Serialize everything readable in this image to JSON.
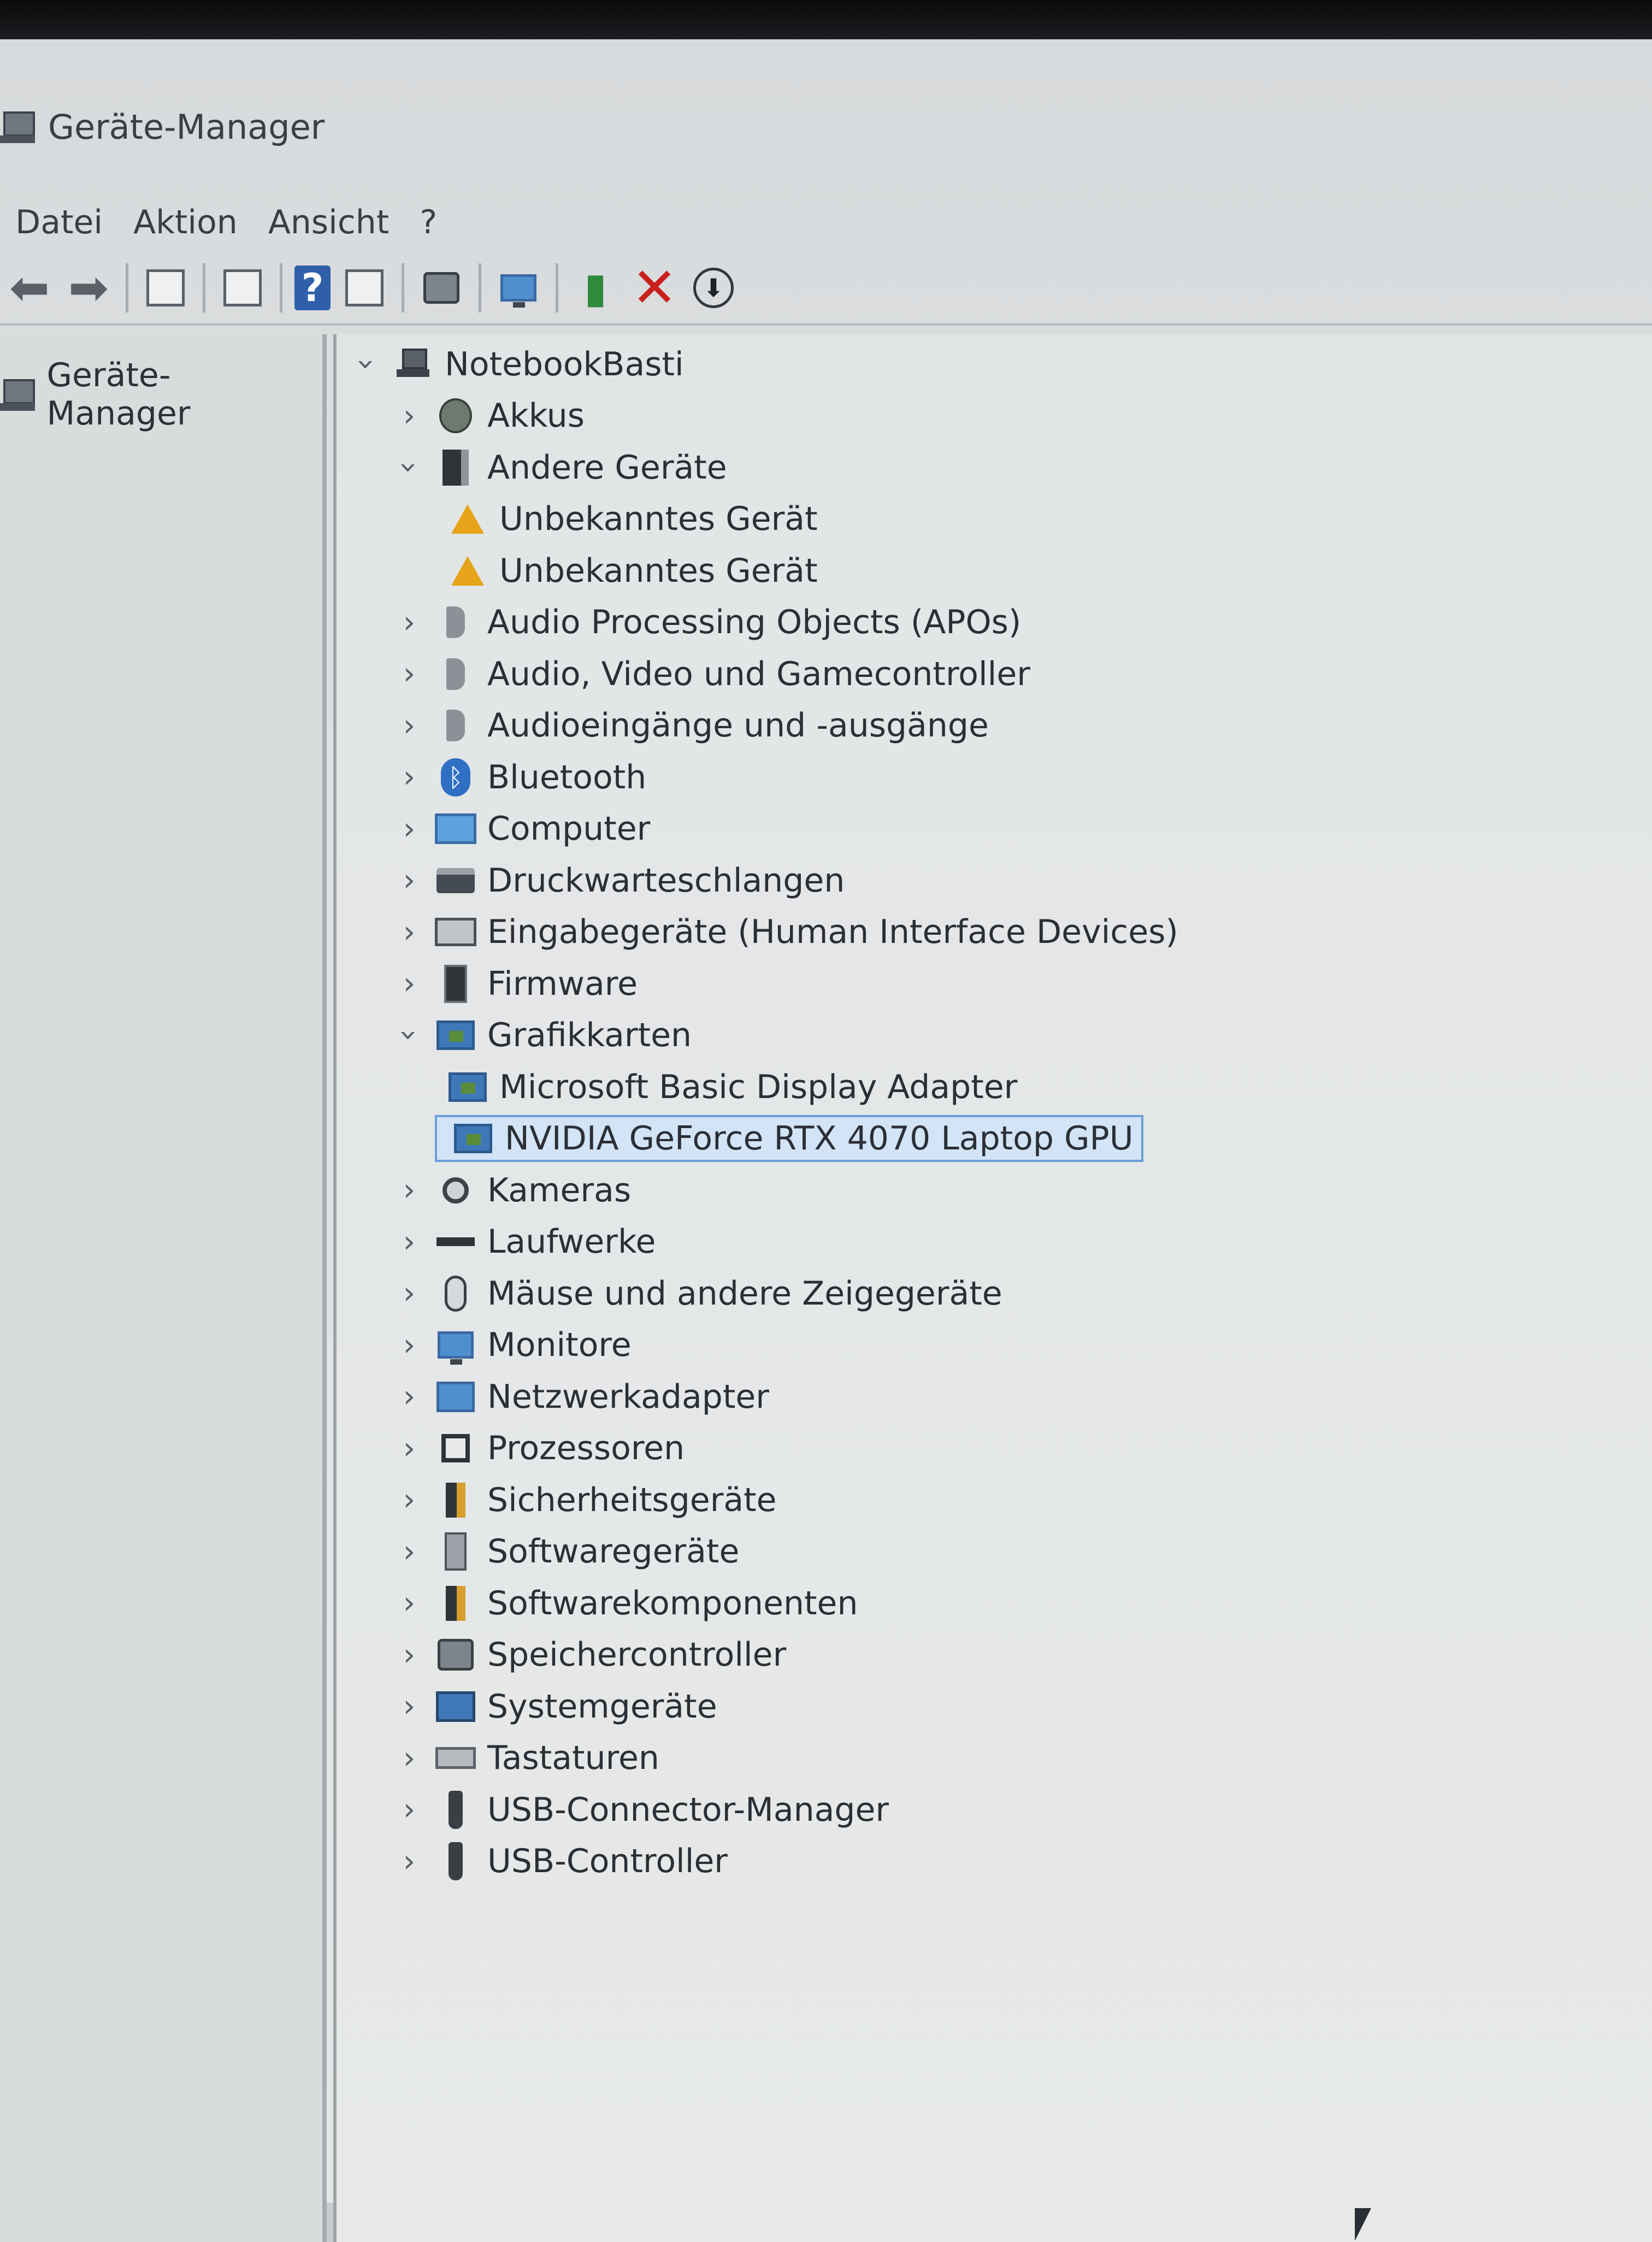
{
  "window": {
    "title": "Geräte-Manager"
  },
  "menu": [
    "Datei",
    "Aktion",
    "Ansicht",
    "?"
  ],
  "toolbar": {
    "buttons": [
      {
        "name": "back",
        "icon": "arrow-left-icon"
      },
      {
        "name": "forward",
        "icon": "arrow-right-icon"
      },
      {
        "name": "show-hide-console-tree",
        "icon": "panel-icon"
      },
      {
        "name": "properties",
        "icon": "properties-icon"
      },
      {
        "name": "help",
        "icon": "help-icon"
      },
      {
        "name": "action-pane",
        "icon": "pane-icon"
      },
      {
        "name": "scan-hardware",
        "icon": "scan-icon"
      },
      {
        "name": "computer",
        "icon": "monitor-icon"
      },
      {
        "name": "update-driver",
        "icon": "update-driver-icon"
      },
      {
        "name": "uninstall",
        "icon": "red-x-icon"
      },
      {
        "name": "disable",
        "icon": "down-arrow-icon"
      }
    ]
  },
  "left_pane": {
    "root_label": "Geräte-Manager"
  },
  "tree": {
    "root": "NotebookBasti",
    "items": [
      {
        "label": "Akkus",
        "icon": "battery-icon",
        "state": "collapsed",
        "level": 1
      },
      {
        "label": "Andere Geräte",
        "icon": "other-devices-icon",
        "state": "expanded",
        "level": 1
      },
      {
        "label": "Unbekanntes Gerät",
        "icon": "warning-device-icon",
        "state": "leaf",
        "level": 2
      },
      {
        "label": "Unbekanntes Gerät",
        "icon": "warning-device-icon",
        "state": "leaf",
        "level": 2
      },
      {
        "label": "Audio Processing Objects (APOs)",
        "icon": "speaker-icon",
        "state": "collapsed",
        "level": 1
      },
      {
        "label": "Audio, Video und Gamecontroller",
        "icon": "speaker-icon",
        "state": "collapsed",
        "level": 1
      },
      {
        "label": "Audioeingänge und -ausgänge",
        "icon": "speaker-icon",
        "state": "collapsed",
        "level": 1
      },
      {
        "label": "Bluetooth",
        "icon": "bluetooth-icon",
        "state": "collapsed",
        "level": 1
      },
      {
        "label": "Computer",
        "icon": "computer-icon",
        "state": "collapsed",
        "level": 1
      },
      {
        "label": "Druckwarteschlangen",
        "icon": "printer-icon",
        "state": "collapsed",
        "level": 1
      },
      {
        "label": "Eingabegeräte (Human Interface Devices)",
        "icon": "hid-icon",
        "state": "collapsed",
        "level": 1
      },
      {
        "label": "Firmware",
        "icon": "firmware-icon",
        "state": "collapsed",
        "level": 1
      },
      {
        "label": "Grafikkarten",
        "icon": "display-adapter-icon",
        "state": "expanded",
        "level": 1
      },
      {
        "label": "Microsoft Basic Display Adapter",
        "icon": "display-adapter-icon",
        "state": "leaf",
        "level": 2
      },
      {
        "label": "NVIDIA GeForce RTX 4070 Laptop GPU",
        "icon": "display-adapter-icon",
        "state": "leaf",
        "level": 2,
        "selected": true
      },
      {
        "label": "Kameras",
        "icon": "camera-icon",
        "state": "collapsed",
        "level": 1
      },
      {
        "label": "Laufwerke",
        "icon": "drive-icon",
        "state": "collapsed",
        "level": 1
      },
      {
        "label": "Mäuse und andere Zeigegeräte",
        "icon": "mouse-icon",
        "state": "collapsed",
        "level": 1
      },
      {
        "label": "Monitore",
        "icon": "monitor-icon",
        "state": "collapsed",
        "level": 1
      },
      {
        "label": "Netzwerkadapter",
        "icon": "network-icon",
        "state": "collapsed",
        "level": 1
      },
      {
        "label": "Prozessoren",
        "icon": "processor-icon",
        "state": "collapsed",
        "level": 1
      },
      {
        "label": "Sicherheitsgeräte",
        "icon": "security-icon",
        "state": "collapsed",
        "level": 1
      },
      {
        "label": "Softwaregeräte",
        "icon": "software-device-icon",
        "state": "collapsed",
        "level": 1
      },
      {
        "label": "Softwarekomponenten",
        "icon": "software-component-icon",
        "state": "collapsed",
        "level": 1
      },
      {
        "label": "Speichercontroller",
        "icon": "storage-controller-icon",
        "state": "collapsed",
        "level": 1
      },
      {
        "label": "Systemgeräte",
        "icon": "system-device-icon",
        "state": "collapsed",
        "level": 1
      },
      {
        "label": "Tastaturen",
        "icon": "keyboard-icon",
        "state": "collapsed",
        "level": 1
      },
      {
        "label": "USB-Connector-Manager",
        "icon": "usb-icon",
        "state": "collapsed",
        "level": 1
      },
      {
        "label": "USB-Controller",
        "icon": "usb-icon",
        "state": "collapsed",
        "level": 1
      }
    ]
  },
  "colors": {
    "selection_bg": "#d3e4f7",
    "selection_border": "#6a9fdb",
    "uninstall_red": "#c9201e",
    "help_blue": "#2f5fa8"
  }
}
